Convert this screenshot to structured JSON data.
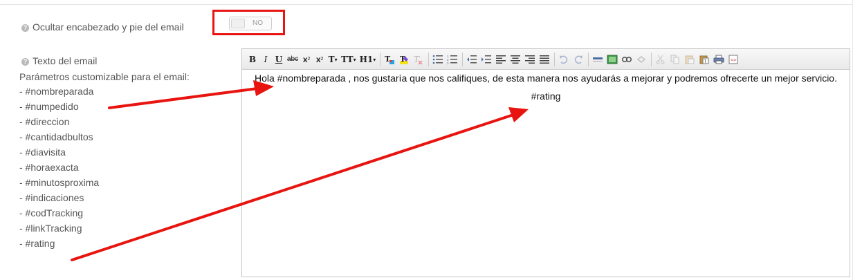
{
  "header_toggle": {
    "label": "Ocultar encabezado y pie del email",
    "state": "NO"
  },
  "email_text": {
    "title": "Texto del email",
    "description": "Parámetros customizable para el email:",
    "parameters": [
      "- #nombreparada",
      "- #numpedido",
      "- #direccion",
      "- #cantidadbultos",
      "- #diavisita",
      "- #horaexacta",
      "- #minutosproxima",
      "- #indicaciones",
      "- #codTracking",
      "- #linkTracking",
      "- #rating"
    ]
  },
  "editor": {
    "toolbar": {
      "bold": "B",
      "italic": "I",
      "underline": "U",
      "strike": "abc",
      "subscript": "x",
      "superscript": "x",
      "font_family": "T",
      "font_size": "TT",
      "heading": "H1"
    },
    "content": {
      "line1": "Hola #nombreparada , nos gustaría que nos califiques, de esta manera nos ayudarás a mejorar y podremos ofrecerte un mejor servicio.",
      "line2": "#rating"
    }
  },
  "colors": {
    "annotation_red": "#e8140f",
    "toggle_border": "#cfcfcf"
  }
}
